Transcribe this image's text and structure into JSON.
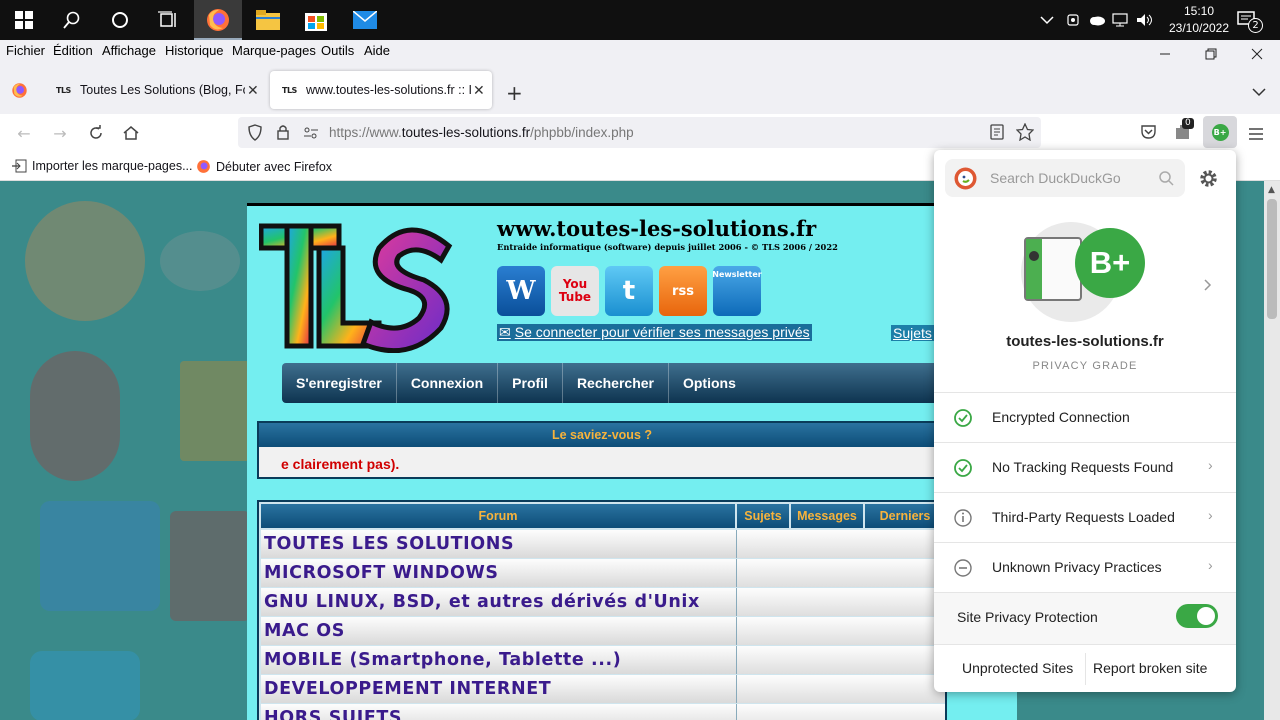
{
  "taskbar": {
    "time": "15:10",
    "date": "23/10/2022",
    "notification_count": "2"
  },
  "menubar": {
    "items": [
      "Fichier",
      "Édition",
      "Affichage",
      "Historique",
      "Marque-pages",
      "Outils",
      "Aide"
    ]
  },
  "tabs": [
    {
      "favicon": "TLS",
      "title": "Toutes Les Solutions (Blog, Forum",
      "selected": false
    },
    {
      "favicon": "TLS",
      "title": "www.toutes-les-solutions.fr :: In",
      "selected": true
    }
  ],
  "urlbar": {
    "url_prefix": "https://www.",
    "url_host": "toutes-les-solutions.fr",
    "url_path": "/phpbb/index.php"
  },
  "extension_badge": "0",
  "ddg_button": "B+",
  "bookmarks": [
    "Importer les marque-pages...",
    "Débuter avec Firefox"
  ],
  "page": {
    "site_title": "www.toutes-les-solutions.fr",
    "site_subtitle": "Entraide informatique (software) depuis juillet 2006 - © TLS 2006 / 2022",
    "logo_text": "TLS",
    "social": [
      "W",
      "You Tube",
      "t",
      "rss",
      "Newsletter"
    ],
    "pm_link": "Se connecter pour vérifier ses messages privés",
    "sujets_link": "Sujets",
    "nav": [
      "S'enregistrer",
      "Connexion",
      "Profil",
      "Rechercher",
      "Options"
    ],
    "tip_header": "Le saviez-vous ?",
    "tip_text": "e clairement pas).",
    "table_headers": [
      "Forum",
      "Sujets",
      "Messages",
      "Derniers"
    ],
    "forums": [
      "TOUTES LES SOLUTIONS",
      "MICROSOFT WINDOWS",
      "GNU LINUX, BSD, et autres dérivés d'Unix",
      "MAC OS",
      "MOBILE (Smartphone, Tablette ...)",
      "DEVELOPPEMENT INTERNET",
      "HORS SUJETS"
    ]
  },
  "ddg": {
    "search_placeholder": "Search DuckDuckGo",
    "grade": "B+",
    "site": "toutes-les-solutions.fr",
    "grade_label": "PRIVACY GRADE",
    "rows": [
      {
        "label": "Encrypted Connection",
        "status": "ok",
        "chevron": false
      },
      {
        "label": "No Tracking Requests Found",
        "status": "ok",
        "chevron": true
      },
      {
        "label": "Third-Party Requests Loaded",
        "status": "info",
        "chevron": true
      },
      {
        "label": "Unknown Privacy Practices",
        "status": "neutral",
        "chevron": true
      }
    ],
    "protection_label": "Site Privacy Protection",
    "protection_on": true,
    "unprotected_sites": "Unprotected Sites",
    "report_broken": "Report broken site"
  }
}
